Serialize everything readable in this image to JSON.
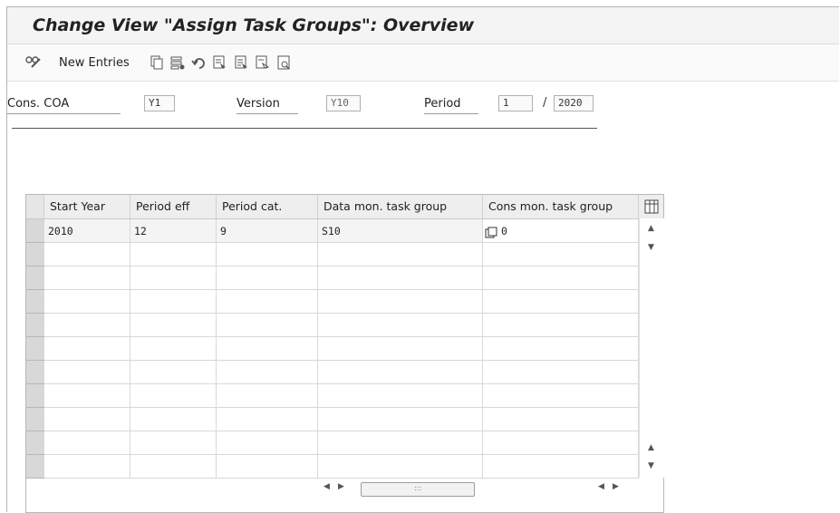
{
  "window": {
    "title": "Change View \"Assign Task Groups\": Overview"
  },
  "toolbar": {
    "new_entries_label": "New Entries",
    "icons": [
      "display-change-icon",
      "copy-icon",
      "delete-icon",
      "undo-icon",
      "select-all-icon",
      "select-block-icon",
      "deselect-all-icon",
      "print-icon"
    ]
  },
  "header": {
    "cons_coa_label": "Cons. COA",
    "cons_coa_value": "Y1",
    "version_label": "Version",
    "version_value": "Y10",
    "period_label": "Period",
    "period_value": "1",
    "year_separator": "/",
    "year_value": "2020"
  },
  "table": {
    "columns": [
      "Start Year",
      "Period eff",
      "Period cat.",
      "Data mon. task group",
      "Cons mon. task group"
    ],
    "rows": [
      [
        "2010",
        "12",
        "9",
        "S10",
        "0"
      ],
      [
        "",
        "",
        "",
        "",
        ""
      ],
      [
        "",
        "",
        "",
        "",
        ""
      ],
      [
        "",
        "",
        "",
        "",
        ""
      ],
      [
        "",
        "",
        "",
        "",
        ""
      ],
      [
        "",
        "",
        "",
        "",
        ""
      ],
      [
        "",
        "",
        "",
        "",
        ""
      ],
      [
        "",
        "",
        "",
        "",
        ""
      ],
      [
        "",
        "",
        "",
        "",
        ""
      ],
      [
        "",
        "",
        "",
        "",
        ""
      ],
      [
        "",
        "",
        "",
        "",
        ""
      ]
    ]
  }
}
